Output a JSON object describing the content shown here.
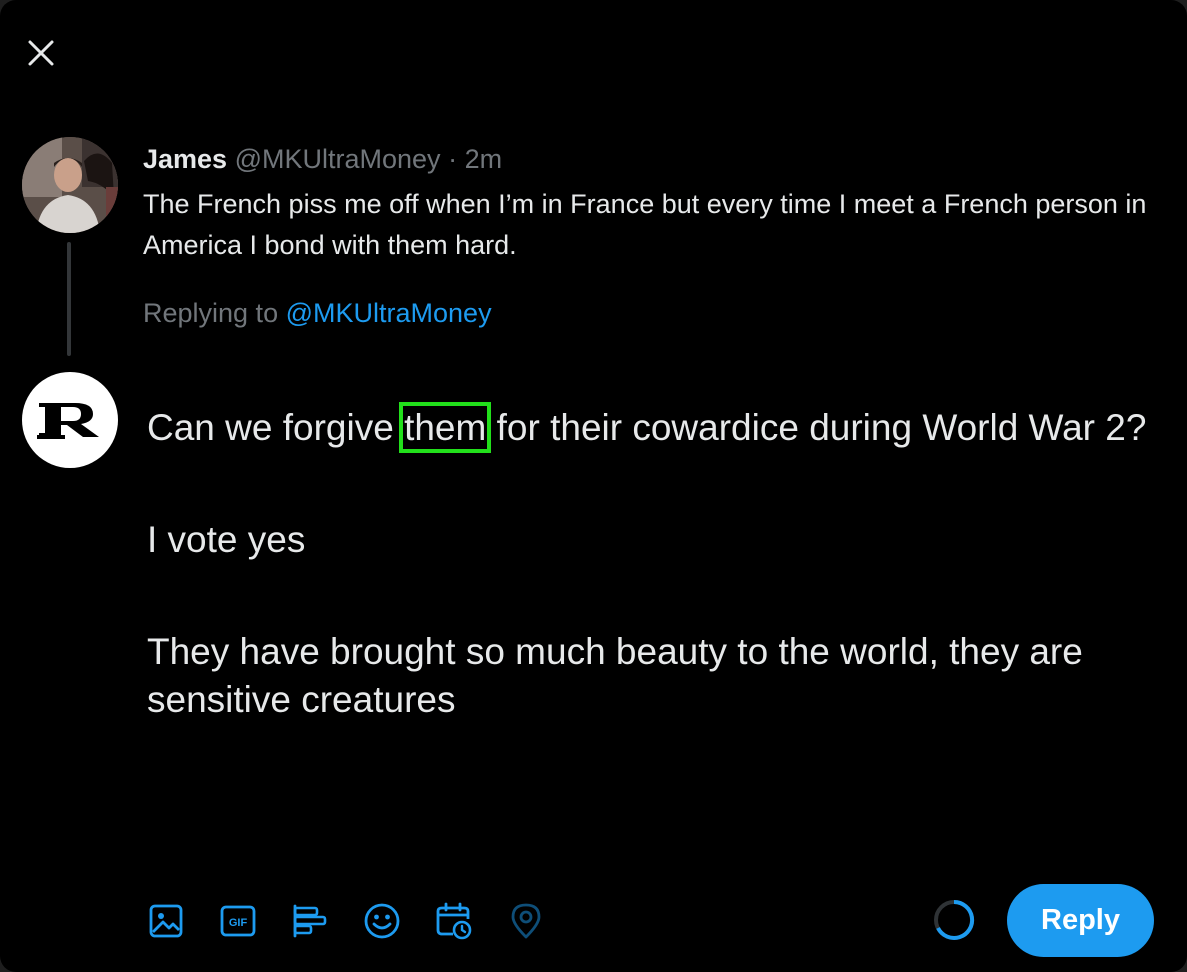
{
  "original_tweet": {
    "author_name": "James",
    "author_handle": "@MKUltraMoney",
    "separator": "·",
    "time": "2m",
    "text": "The French piss me off when I’m in France but every time I meet a French person in America I bond with them hard."
  },
  "replying_to": {
    "label": "Replying to",
    "handle": "@MKUltraMoney"
  },
  "compose": {
    "line1_before": "Can we forgive ",
    "line1_highlight": "them",
    "line1_after": " for their cowardice during World War 2?",
    "line2": "I vote yes",
    "line3": "They have brought so much beauty to the world, they are sensitive creatures"
  },
  "toolbar": {
    "icons": [
      "image-icon",
      "gif-icon",
      "poll-icon",
      "emoji-icon",
      "schedule-icon",
      "location-icon"
    ],
    "gif_label": "GIF"
  },
  "reply_button": {
    "label": "Reply"
  },
  "colors": {
    "accent": "#1d9bf0",
    "background": "#000000",
    "text_primary": "#e7e9ea",
    "text_secondary": "#71767b",
    "highlight_box": "#22e01b"
  }
}
